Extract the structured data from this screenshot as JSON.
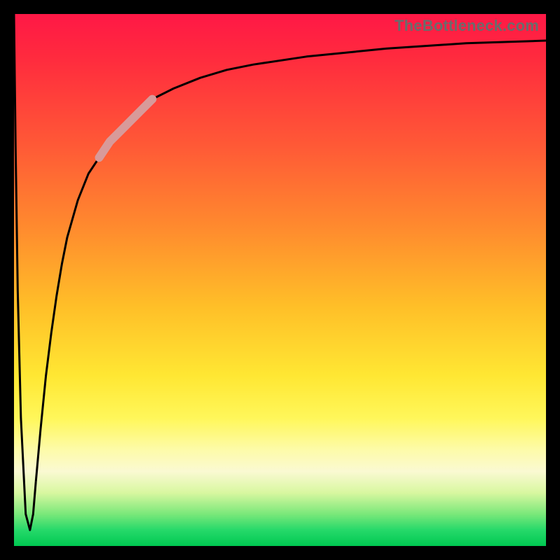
{
  "watermark": "TheBottleneck.com",
  "chart_data": {
    "type": "line",
    "title": "",
    "xlabel": "",
    "ylabel": "",
    "xlim": [
      0,
      100
    ],
    "ylim": [
      0,
      100
    ],
    "grid": false,
    "legend": false,
    "background_gradient": {
      "direction": "vertical",
      "stops": [
        {
          "pct": 0,
          "color": "#ff1846"
        },
        {
          "pct": 25,
          "color": "#ff5a36"
        },
        {
          "pct": 55,
          "color": "#ffbf28"
        },
        {
          "pct": 76,
          "color": "#fff75a"
        },
        {
          "pct": 90,
          "color": "#d8f7a0"
        },
        {
          "pct": 100,
          "color": "#00c851"
        }
      ]
    },
    "series": [
      {
        "name": "dip",
        "color": "#000000",
        "stroke_width": 3,
        "x": [
          0,
          0.3,
          0.7,
          1.3,
          2.2,
          3.0,
          3.6,
          4.1
        ],
        "y": [
          100,
          75,
          48,
          24,
          6,
          3,
          6,
          12
        ]
      },
      {
        "name": "recovery",
        "color": "#000000",
        "stroke_width": 3,
        "x": [
          4.1,
          5,
          6,
          7,
          8,
          9,
          10,
          12,
          14,
          16,
          18,
          20,
          22,
          24,
          26,
          30,
          35,
          40,
          45,
          55,
          70,
          85,
          100
        ],
        "y": [
          12,
          22,
          32,
          40,
          47,
          53,
          58,
          65,
          70,
          73,
          76,
          78,
          80,
          82,
          84,
          86,
          88,
          89.5,
          90.5,
          92,
          93.5,
          94.5,
          95
        ]
      },
      {
        "name": "highlight-segment",
        "color": "#d89a9a",
        "stroke_width": 12,
        "linecap": "round",
        "x": [
          16,
          18,
          20,
          22,
          24,
          26
        ],
        "y": [
          73,
          76,
          78,
          80,
          82,
          84
        ]
      }
    ]
  }
}
